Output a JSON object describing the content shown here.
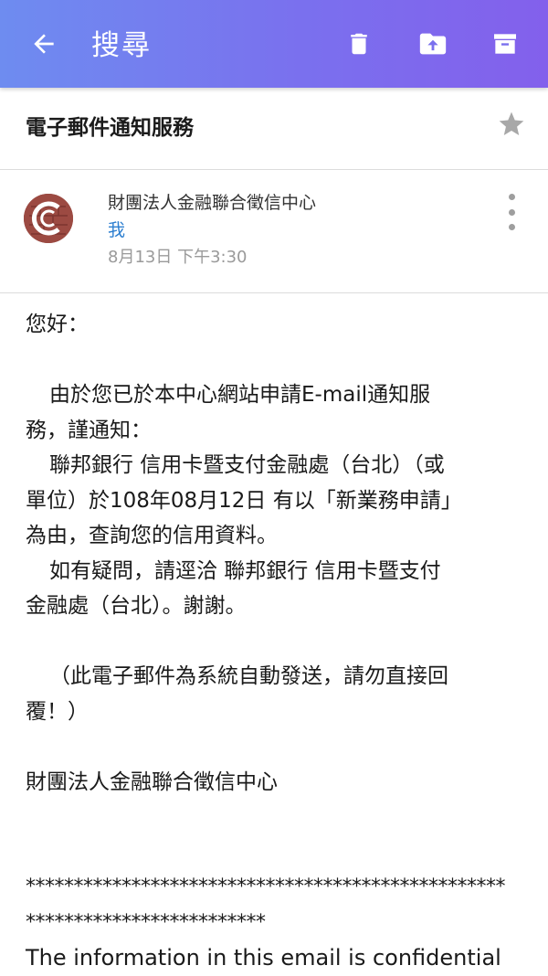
{
  "appbar": {
    "title": "搜尋",
    "icons": {
      "back": "arrow-left-icon",
      "delete": "trash-icon",
      "move": "folder-upload-icon",
      "archive": "archive-box-icon"
    }
  },
  "subject": {
    "text": "電子郵件通知服務",
    "star_icon": "star-icon"
  },
  "sender": {
    "name": "財團法人金融聯合徵信中心",
    "to": "我",
    "date": "8月13日 下午3:30",
    "more_icon": "more-vertical-icon"
  },
  "body": {
    "greeting": "您好：",
    "lines": [
      "由於您已於本中心網站申請E-mail通知服",
      "務，謹通知：",
      "聯邦銀行  信用卡暨支付金融處（台北）（或",
      "單位）於108年08月12日 有以「新業務申請」",
      "為由，查詢您的信用資料。",
      "如有疑問，請逕洽 聯邦銀行  信用卡暨支付",
      "金融處（台北）。謝謝。"
    ],
    "notice_line1": "（此電子郵件為系統自動發送，請勿直接回",
    "notice_line2": "覆！）",
    "signature": "財團法人金融聯合徵信中心",
    "stars_line1": "**************************************************",
    "stars_line2": "*************************",
    "english_line": "The information in this email is confidential"
  },
  "colors": {
    "appbar_start": "#6e8cf0",
    "appbar_end": "#8360ec",
    "link_blue": "#2d7fd0",
    "muted_gray": "#9a9a9a"
  }
}
